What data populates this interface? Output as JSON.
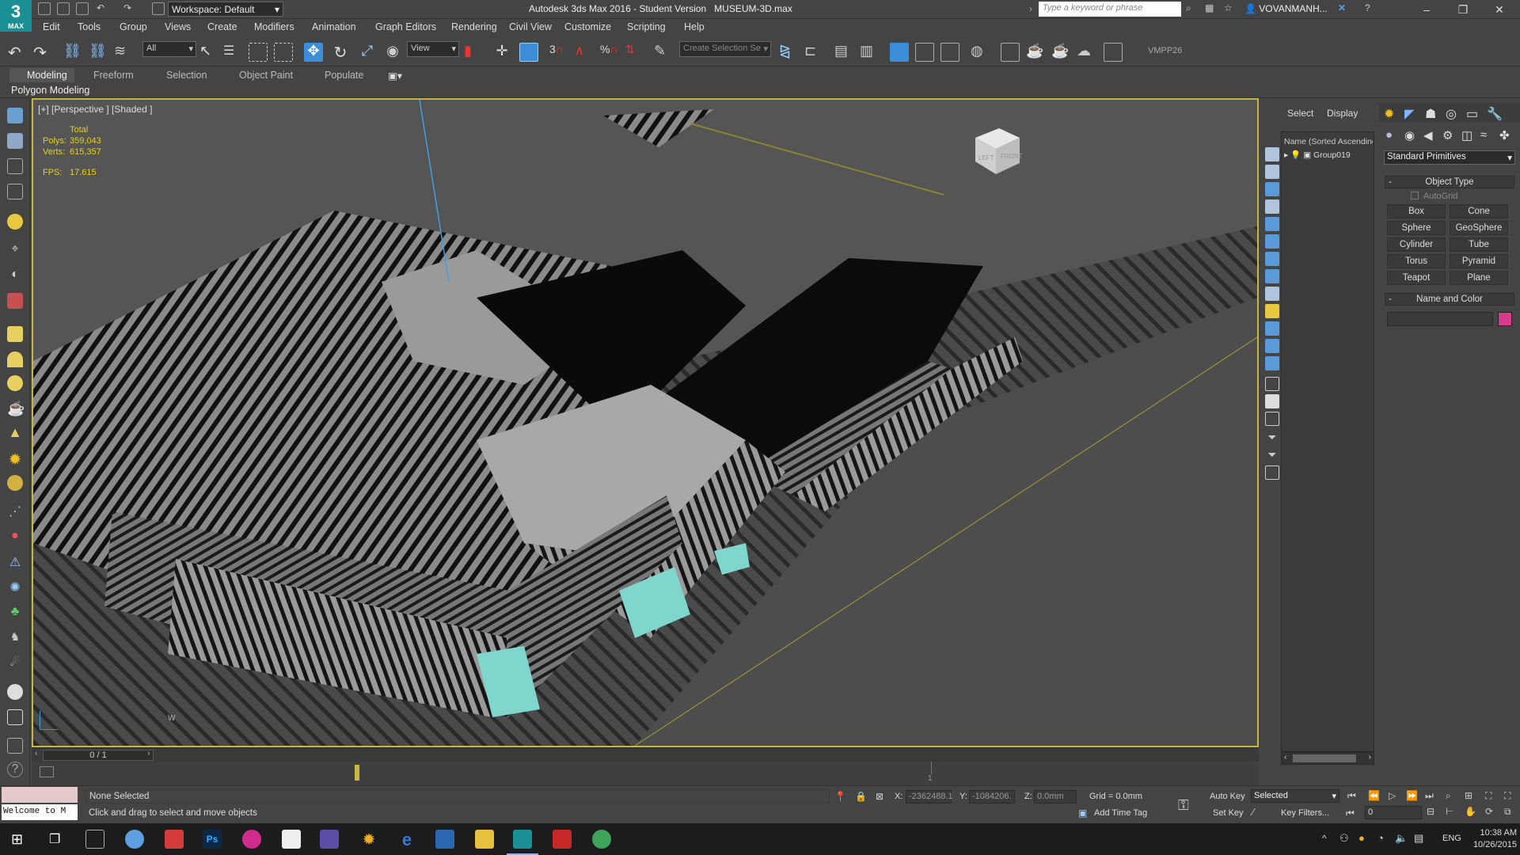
{
  "app": {
    "logo_text": "3",
    "logo_sub": "MAX",
    "workspace": "Workspace: Default",
    "title": "Autodesk 3ds Max 2016 - Student Version",
    "file_name": "MUSEUM-3D.max",
    "search_placeholder": "Type a keyword or phrase",
    "user": "VOVANMANH...",
    "window_buttons": [
      "–",
      "❐",
      "✕"
    ]
  },
  "menus": [
    "Edit",
    "Tools",
    "Group",
    "Views",
    "Create",
    "Modifiers",
    "Animation",
    "Graph Editors",
    "Rendering",
    "Civil View",
    "Customize",
    "Scripting",
    "Help"
  ],
  "toolbar": {
    "selection_filter": "All",
    "ref_coord": "View",
    "named_selection": "Create Selection Se",
    "tag": "VMPP26"
  },
  "ribbon": {
    "tabs": [
      "Modeling",
      "Freeform",
      "Selection",
      "Object Paint",
      "Populate"
    ],
    "active_tab": "Modeling",
    "panel_label": "Polygon Modeling"
  },
  "viewport": {
    "label": "[+] [Perspective ] [Shaded ]",
    "stats": {
      "total_label": "Total",
      "polys_label": "Polys:",
      "polys": "359,043",
      "verts_label": "Verts:",
      "verts": "615,357",
      "fps_label": "FPS:",
      "fps": "17.615"
    },
    "viewcube_left": "LEFT",
    "viewcube_front": "FRONT",
    "compass_letter": "W"
  },
  "scene_explorer": {
    "tabs": [
      "Select",
      "Display"
    ],
    "column": "Name (Sorted Ascending)",
    "items": [
      "Group019"
    ]
  },
  "command_panel": {
    "dropdown": "Standard Primitives",
    "object_type_title": "Object Type",
    "autogrid": "AutoGrid",
    "buttons": [
      "Box",
      "Cone",
      "Sphere",
      "GeoSphere",
      "Cylinder",
      "Tube",
      "Torus",
      "Pyramid",
      "Teapot",
      "Plane"
    ],
    "name_color_title": "Name and Color",
    "color": "#d63c8a"
  },
  "timeline": {
    "frame": "0 / 1",
    "track_tick": "1"
  },
  "status": {
    "listener": "Welcome to M",
    "selection": "None Selected",
    "prompt": "Click and drag to select and move objects",
    "x_label": "X:",
    "x_value": "-2362488.1",
    "y_label": "Y:",
    "y_value": "-1084206.",
    "z_label": "Z:",
    "z_value": "0.0mm",
    "grid": "Grid = 0.0mm",
    "add_time_tag": "Add Time Tag",
    "auto_key": "Auto Key",
    "set_key": "Set Key",
    "key_mode": "Selected",
    "key_filters": "Key Filters...",
    "frame_field": "0"
  },
  "taskbar": {
    "lang": "ENG",
    "time": "10:38 AM",
    "date": "10/26/2015"
  }
}
